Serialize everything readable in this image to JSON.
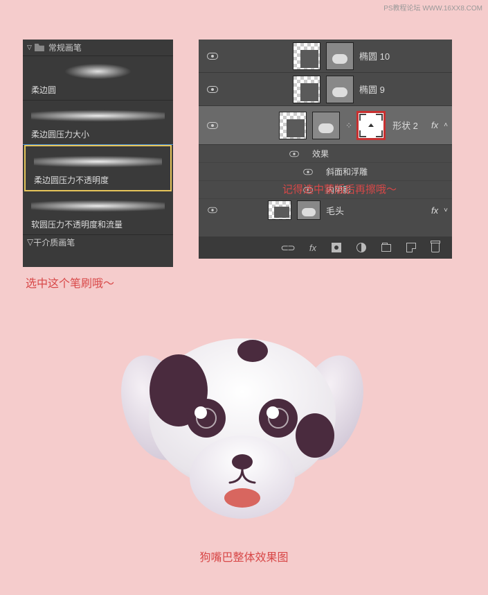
{
  "watermark": "PS教程论坛 WWW.16XX8.COM",
  "brush_panel": {
    "header": "常规画笔",
    "items": [
      {
        "label": "柔边圆"
      },
      {
        "label": "柔边圆压力大小"
      },
      {
        "label": "柔边圆压力不透明度"
      },
      {
        "label": "软圆压力不透明度和流量"
      }
    ],
    "footer": "干介质画笔",
    "note": "选中这个笔刷哦～"
  },
  "layers_panel": {
    "layers": [
      {
        "name": "椭圆 10"
      },
      {
        "name": "椭圆 9"
      },
      {
        "name": "形状 2",
        "fx": "fx"
      },
      {
        "name": "毛头",
        "fx": "fx"
      }
    ],
    "effects": {
      "title": "效果",
      "items": [
        "斜面和浮雕",
        "内阴影"
      ]
    },
    "note": "记得选中蒙版后再擦哦～"
  },
  "dog_caption": "狗嘴巴整体效果图"
}
